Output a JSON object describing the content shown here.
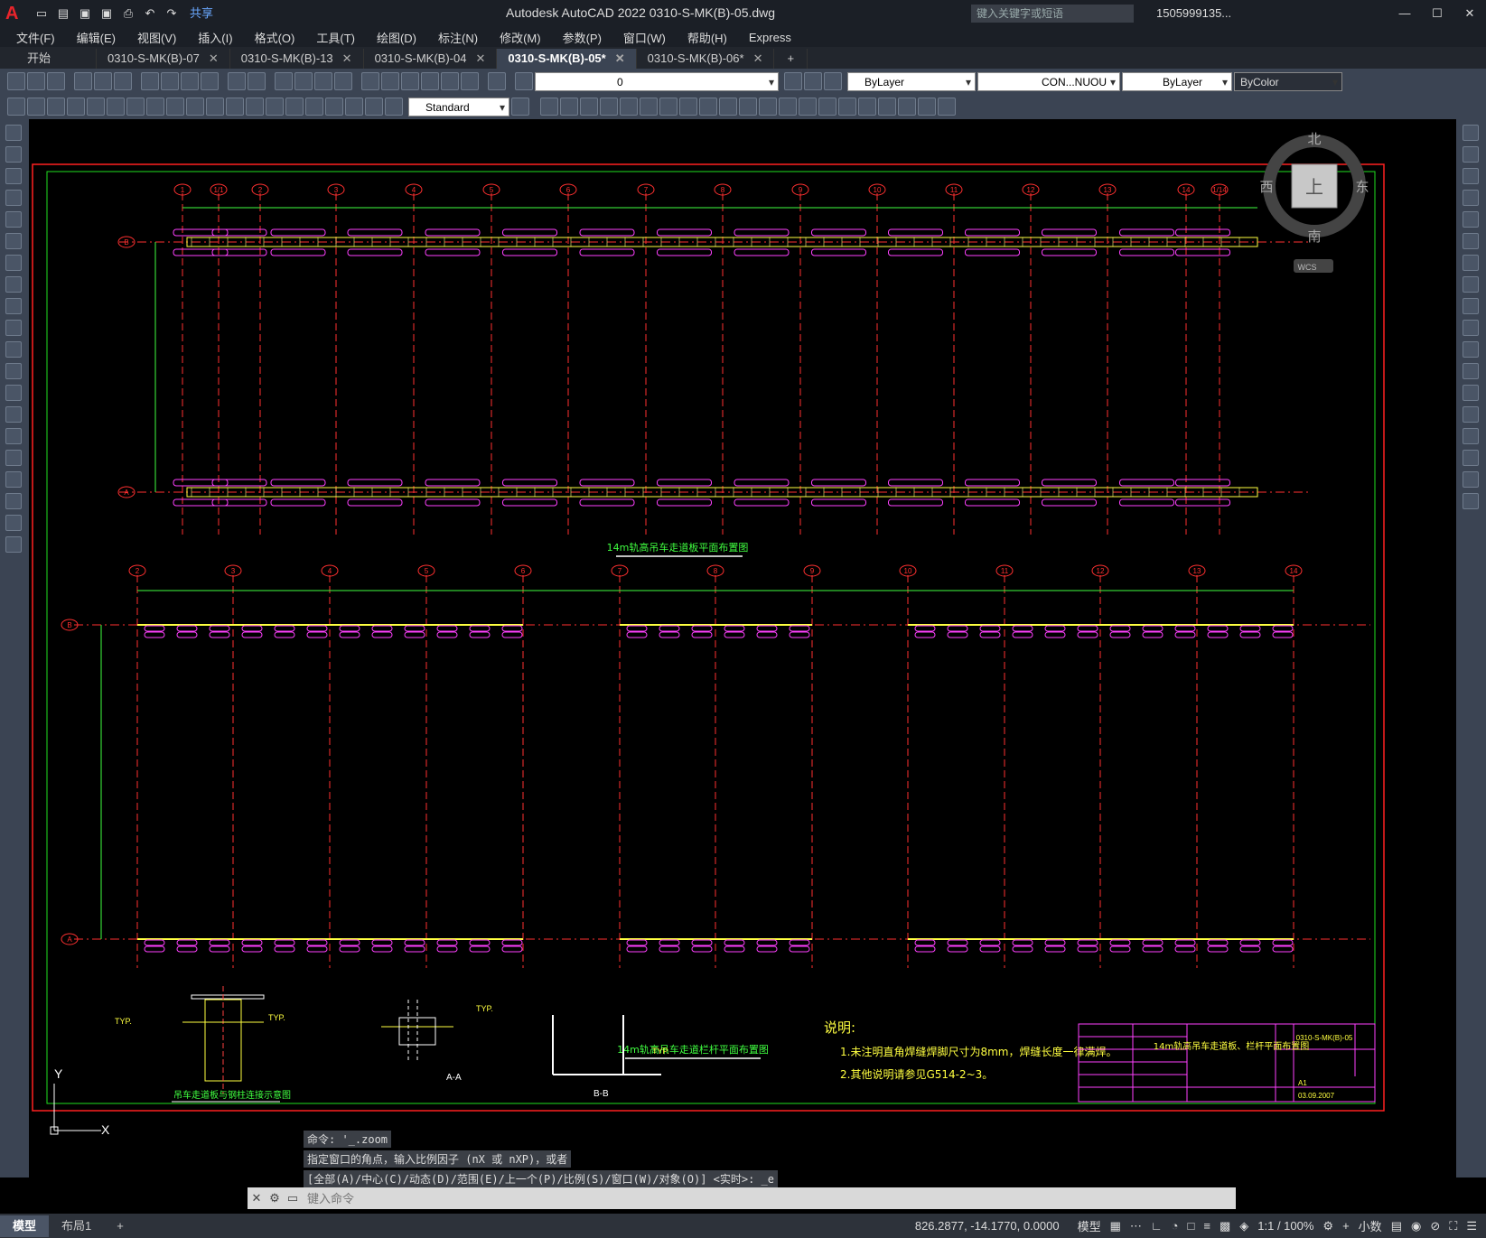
{
  "app": {
    "title": "Autodesk AutoCAD 2022    0310-S-MK(B)-05.dwg",
    "logo": "A",
    "share": "共享"
  },
  "search": {
    "placeholder": "键入关键字或短语"
  },
  "user": {
    "name": "1505999135..."
  },
  "menu": [
    "文件(F)",
    "编辑(E)",
    "视图(V)",
    "插入(I)",
    "格式(O)",
    "工具(T)",
    "绘图(D)",
    "标注(N)",
    "修改(M)",
    "参数(P)",
    "窗口(W)",
    "帮助(H)",
    "Express"
  ],
  "tabs": [
    {
      "label": "开始",
      "closable": false
    },
    {
      "label": "0310-S-MK(B)-07",
      "closable": true
    },
    {
      "label": "0310-S-MK(B)-13",
      "closable": true
    },
    {
      "label": "0310-S-MK(B)-04",
      "closable": true
    },
    {
      "label": "0310-S-MK(B)-05*",
      "closable": true,
      "active": true
    },
    {
      "label": "0310-S-MK(B)-06*",
      "closable": true
    }
  ],
  "toolbar": {
    "layer": "0",
    "color": "ByLayer",
    "linetype": "CON...NUOU",
    "lineweight": "ByLayer",
    "plotstyle": "ByColor",
    "textstyle": "Standard"
  },
  "viewcube": {
    "n": "北",
    "s": "南",
    "e": "东",
    "w": "西",
    "top": "上",
    "wcs": "WCS"
  },
  "drawing": {
    "plan1_title": "14m轨高吊车走道板平面布置图",
    "plan2_title": "14m轨高吊车走道栏杆平面布置图",
    "detail1_title": "吊车走道板与钢柱连接示意图",
    "detail2_label": "A-A",
    "detail3_label": "B-B",
    "notes_title": "说明:",
    "note1": "1.未注明直角焊缝焊脚尺寸为8mm，焊缝长度一律满焊。",
    "note2": "2.其他说明请参见G514-2~3。",
    "tb_title": "14m轨高吊车走道板、栏杆平面布置图",
    "tb_dwgno": "0310-S-MK(B)-05",
    "tb_date": "03.09.2007",
    "tb_scale": "A1",
    "axis_top": [
      "1",
      "1/1",
      "2",
      "3",
      "4",
      "5",
      "6",
      "7",
      "8",
      "9",
      "10",
      "11",
      "12",
      "13",
      "14",
      "1/14"
    ],
    "axis_mid": [
      "2",
      "3",
      "4",
      "5",
      "6",
      "7",
      "8",
      "9",
      "10",
      "11",
      "12",
      "13",
      "14"
    ],
    "row_b": "B",
    "row_a": "A",
    "ucs_y": "Y",
    "ucs_x": "X"
  },
  "command": {
    "hist1": "命令: '_.zoom",
    "hist2": "指定窗口的角点，输入比例因子 (nX 或 nXP)，或者",
    "hist3": "[全部(A)/中心(C)/动态(D)/范围(E)/上一个(P)/比例(S)/窗口(W)/对象(O)] <实时>: _e",
    "placeholder": "键入命令"
  },
  "layouts": [
    "模型",
    "布局1"
  ],
  "status": {
    "coords": "826.2877, -14.1770, 0.0000",
    "space": "模型",
    "scale": "1:1 / 100%",
    "units": "小数"
  }
}
